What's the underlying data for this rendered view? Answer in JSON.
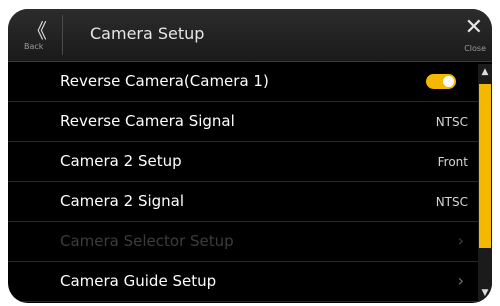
{
  "header": {
    "back_glyph": "《",
    "back_label": "Back",
    "title": "Camera Setup",
    "close_glyph": "✕",
    "close_label": "Close"
  },
  "items": [
    {
      "label": "Reverse Camera(Camera 1)",
      "control": "toggle",
      "toggle_on": true
    },
    {
      "label": "Reverse Camera Signal",
      "value": "NTSC"
    },
    {
      "label": "Camera 2 Setup",
      "value": "Front"
    },
    {
      "label": "Camera 2 Signal",
      "value": "NTSC"
    },
    {
      "label": "Camera Selector Setup",
      "chevron": "›",
      "enabled": false
    },
    {
      "label": "Camera Guide Setup",
      "chevron": "›"
    }
  ],
  "scrollbar": {
    "up": "▲",
    "down": "▼"
  },
  "colors": {
    "accent": "#f5b800",
    "background": "#000000"
  },
  "icons": {
    "back": "back-double-chevron-icon",
    "close": "close-icon",
    "chevron": "chevron-right-icon"
  }
}
